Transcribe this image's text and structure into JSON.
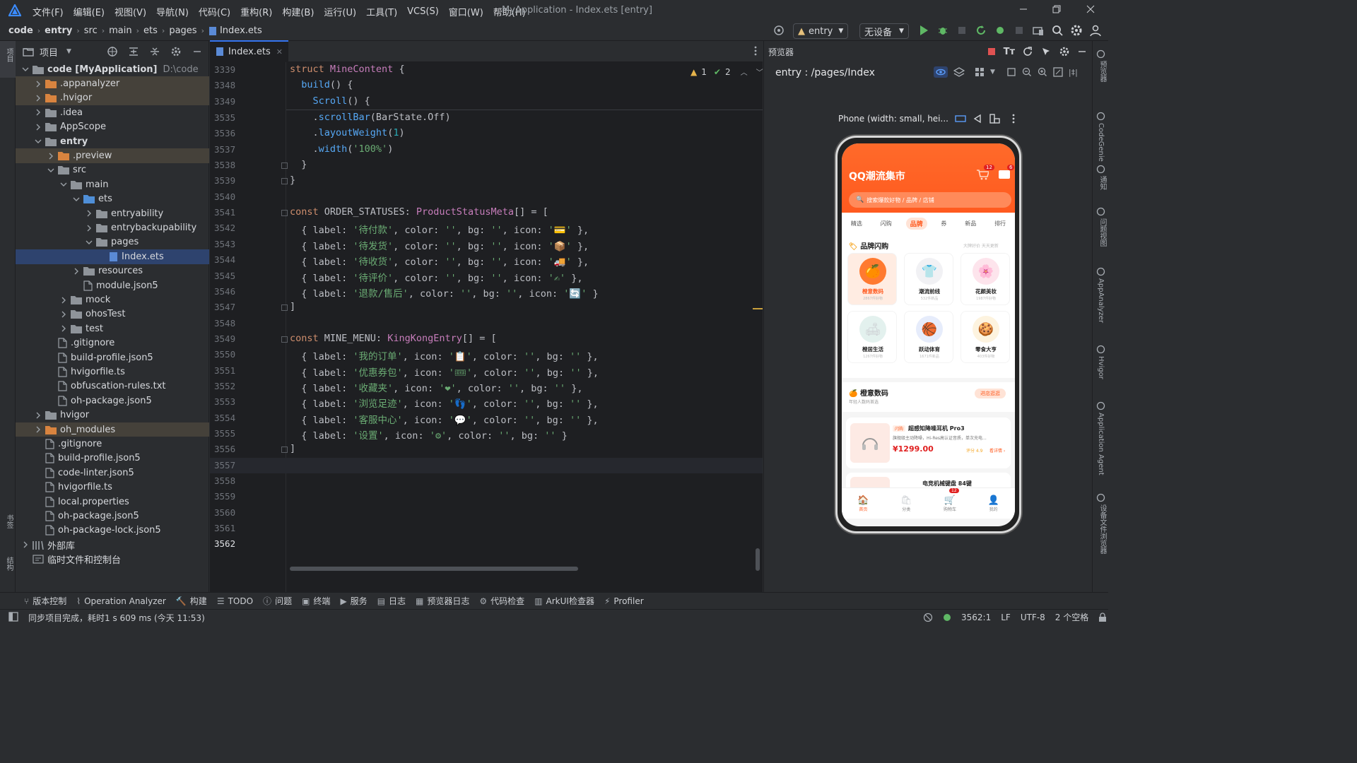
{
  "menu": {
    "items": [
      "文件(F)",
      "编辑(E)",
      "视图(V)",
      "导航(N)",
      "代码(C)",
      "重构(R)",
      "构建(B)",
      "运行(U)",
      "工具(T)",
      "VCS(S)",
      "窗口(W)",
      "帮助(H)"
    ],
    "window_title": "MyApplication - Index.ets [entry]"
  },
  "nav": {
    "breadcrumb": [
      "code",
      "entry",
      "src",
      "main",
      "ets",
      "pages",
      "Index.ets"
    ],
    "run_config": "entry",
    "device": "无设备"
  },
  "project": {
    "title": "项目",
    "rows": [
      {
        "label": "code [MyApplication]",
        "extra": "D:\\code",
        "indent": 0,
        "kind": "folder",
        "exp": "open",
        "bold": true
      },
      {
        "label": ".appanalyzer",
        "indent": 1,
        "kind": "folder-o",
        "exp": "closed",
        "hl": true
      },
      {
        "label": ".hvigor",
        "indent": 1,
        "kind": "folder-o",
        "exp": "closed",
        "hl": true
      },
      {
        "label": ".idea",
        "indent": 1,
        "kind": "folder",
        "exp": "closed"
      },
      {
        "label": "AppScope",
        "indent": 1,
        "kind": "folder",
        "exp": "closed"
      },
      {
        "label": "entry",
        "indent": 1,
        "kind": "folder",
        "exp": "open",
        "bold": true
      },
      {
        "label": ".preview",
        "indent": 2,
        "kind": "folder-o",
        "exp": "closed",
        "hl": true
      },
      {
        "label": "src",
        "indent": 2,
        "kind": "folder",
        "exp": "open"
      },
      {
        "label": "main",
        "indent": 3,
        "kind": "folder",
        "exp": "open"
      },
      {
        "label": "ets",
        "indent": 4,
        "kind": "folder-b",
        "exp": "open"
      },
      {
        "label": "entryability",
        "indent": 5,
        "kind": "folder",
        "exp": "closed"
      },
      {
        "label": "entrybackupability",
        "indent": 5,
        "kind": "folder",
        "exp": "closed"
      },
      {
        "label": "pages",
        "indent": 5,
        "kind": "folder",
        "exp": "open"
      },
      {
        "label": "Index.ets",
        "indent": 6,
        "kind": "file",
        "exp": "none",
        "sel": true
      },
      {
        "label": "resources",
        "indent": 4,
        "kind": "folder",
        "exp": "closed"
      },
      {
        "label": "module.json5",
        "indent": 4,
        "kind": "file",
        "exp": "none"
      },
      {
        "label": "mock",
        "indent": 3,
        "kind": "folder",
        "exp": "closed"
      },
      {
        "label": "ohosTest",
        "indent": 3,
        "kind": "folder",
        "exp": "closed"
      },
      {
        "label": "test",
        "indent": 3,
        "kind": "folder",
        "exp": "closed"
      },
      {
        "label": ".gitignore",
        "indent": 2,
        "kind": "file",
        "exp": "none"
      },
      {
        "label": "build-profile.json5",
        "indent": 2,
        "kind": "file",
        "exp": "none"
      },
      {
        "label": "hvigorfile.ts",
        "indent": 2,
        "kind": "file",
        "exp": "none"
      },
      {
        "label": "obfuscation-rules.txt",
        "indent": 2,
        "kind": "file",
        "exp": "none"
      },
      {
        "label": "oh-package.json5",
        "indent": 2,
        "kind": "file",
        "exp": "none"
      },
      {
        "label": "hvigor",
        "indent": 1,
        "kind": "folder",
        "exp": "closed"
      },
      {
        "label": "oh_modules",
        "indent": 1,
        "kind": "folder-o",
        "exp": "closed",
        "hl": true
      },
      {
        "label": ".gitignore",
        "indent": 1,
        "kind": "file",
        "exp": "none"
      },
      {
        "label": "build-profile.json5",
        "indent": 1,
        "kind": "file",
        "exp": "none"
      },
      {
        "label": "code-linter.json5",
        "indent": 1,
        "kind": "file",
        "exp": "none"
      },
      {
        "label": "hvigorfile.ts",
        "indent": 1,
        "kind": "file",
        "exp": "none"
      },
      {
        "label": "local.properties",
        "indent": 1,
        "kind": "file",
        "exp": "none"
      },
      {
        "label": "oh-package.json5",
        "indent": 1,
        "kind": "file",
        "exp": "none"
      },
      {
        "label": "oh-package-lock.json5",
        "indent": 1,
        "kind": "file",
        "exp": "none"
      },
      {
        "label": "外部库",
        "indent": 0,
        "kind": "lib",
        "exp": "closed"
      },
      {
        "label": "临时文件和控制台",
        "indent": 0,
        "kind": "scratch",
        "exp": "none"
      }
    ]
  },
  "editor": {
    "tab": "Index.ets",
    "warnings": "1",
    "checks": "2",
    "sticky": [
      {
        "n": "3339",
        "t": [
          [
            "kw",
            "struct "
          ],
          [
            "ty",
            "MineContent "
          ],
          [
            "pl",
            "{"
          ]
        ]
      },
      {
        "n": "3348",
        "t": [
          [
            "pl",
            "  "
          ],
          [
            "fn",
            "build"
          ],
          [
            "pl",
            "() {"
          ]
        ]
      },
      {
        "n": "3349",
        "t": [
          [
            "pl",
            "    "
          ],
          [
            "fn",
            "Scroll"
          ],
          [
            "pl",
            "() {"
          ]
        ]
      }
    ],
    "lines": [
      {
        "n": "3535",
        "t": [
          [
            "pl",
            "    ."
          ],
          [
            "fn",
            "scrollBar"
          ],
          [
            "pl",
            "(BarState.Off)"
          ]
        ]
      },
      {
        "n": "3536",
        "t": [
          [
            "pl",
            "    ."
          ],
          [
            "fn",
            "layoutWeight"
          ],
          [
            "pl",
            "("
          ],
          [
            "nu",
            "1"
          ],
          [
            "pl",
            ")"
          ]
        ]
      },
      {
        "n": "3537",
        "t": [
          [
            "pl",
            "    ."
          ],
          [
            "fn",
            "width"
          ],
          [
            "pl",
            "("
          ],
          [
            "st",
            "'100%'"
          ],
          [
            "pl",
            ")"
          ]
        ]
      },
      {
        "n": "3538",
        "t": [
          [
            "pl",
            "  }"
          ]
        ]
      },
      {
        "n": "3539",
        "t": [
          [
            "pl",
            "}"
          ]
        ]
      },
      {
        "n": "3540",
        "t": []
      },
      {
        "n": "3541",
        "t": [
          [
            "kw",
            "const "
          ],
          [
            "pl",
            "ORDER_STATUSES: "
          ],
          [
            "ty",
            "ProductStatusMeta"
          ],
          [
            "pl",
            "[] = ["
          ]
        ]
      },
      {
        "n": "3542",
        "t": [
          [
            "pl",
            "  { label: "
          ],
          [
            "st",
            "'待付款'"
          ],
          [
            "pl",
            ", color: "
          ],
          [
            "st",
            "''"
          ],
          [
            "pl",
            ", bg: "
          ],
          [
            "st",
            "''"
          ],
          [
            "pl",
            ", icon: "
          ],
          [
            "st",
            "'💳'"
          ],
          [
            "pl",
            " },"
          ]
        ]
      },
      {
        "n": "3543",
        "t": [
          [
            "pl",
            "  { label: "
          ],
          [
            "st",
            "'待发货'"
          ],
          [
            "pl",
            ", color: "
          ],
          [
            "st",
            "''"
          ],
          [
            "pl",
            ", bg: "
          ],
          [
            "st",
            "''"
          ],
          [
            "pl",
            ", icon: "
          ],
          [
            "st",
            "'📦'"
          ],
          [
            "pl",
            " },"
          ]
        ]
      },
      {
        "n": "3544",
        "t": [
          [
            "pl",
            "  { label: "
          ],
          [
            "st",
            "'待收货'"
          ],
          [
            "pl",
            ", color: "
          ],
          [
            "st",
            "''"
          ],
          [
            "pl",
            ", bg: "
          ],
          [
            "st",
            "''"
          ],
          [
            "pl",
            ", icon: "
          ],
          [
            "st",
            "'🚚'"
          ],
          [
            "pl",
            " },"
          ]
        ]
      },
      {
        "n": "3545",
        "t": [
          [
            "pl",
            "  { label: "
          ],
          [
            "st",
            "'待评价'"
          ],
          [
            "pl",
            ", color: "
          ],
          [
            "st",
            "''"
          ],
          [
            "pl",
            ", bg: "
          ],
          [
            "st",
            "''"
          ],
          [
            "pl",
            ", icon: "
          ],
          [
            "st",
            "'✍'"
          ],
          [
            "pl",
            " },"
          ]
        ]
      },
      {
        "n": "3546",
        "t": [
          [
            "pl",
            "  { label: "
          ],
          [
            "st",
            "'退款/售后'"
          ],
          [
            "pl",
            ", color: "
          ],
          [
            "st",
            "''"
          ],
          [
            "pl",
            ", bg: "
          ],
          [
            "st",
            "''"
          ],
          [
            "pl",
            ", icon: "
          ],
          [
            "st",
            "'🔄'"
          ],
          [
            "pl",
            " }"
          ]
        ]
      },
      {
        "n": "3547",
        "t": [
          [
            "pl",
            "]"
          ]
        ]
      },
      {
        "n": "3548",
        "t": []
      },
      {
        "n": "3549",
        "t": [
          [
            "kw",
            "const "
          ],
          [
            "pl",
            "MINE_MENU: "
          ],
          [
            "ty",
            "KingKongEntry"
          ],
          [
            "pl",
            "[] = ["
          ]
        ]
      },
      {
        "n": "3550",
        "t": [
          [
            "pl",
            "  { label: "
          ],
          [
            "st",
            "'我的订单'"
          ],
          [
            "pl",
            ", icon: "
          ],
          [
            "st",
            "'📋'"
          ],
          [
            "pl",
            ", color: "
          ],
          [
            "st",
            "''"
          ],
          [
            "pl",
            ", bg: "
          ],
          [
            "st",
            "''"
          ],
          [
            "pl",
            " },"
          ]
        ]
      },
      {
        "n": "3551",
        "t": [
          [
            "pl",
            "  { label: "
          ],
          [
            "st",
            "'优惠券包'"
          ],
          [
            "pl",
            ", icon: "
          ],
          [
            "st",
            "'🎟'"
          ],
          [
            "pl",
            ", color: "
          ],
          [
            "st",
            "''"
          ],
          [
            "pl",
            ", bg: "
          ],
          [
            "st",
            "''"
          ],
          [
            "pl",
            " },"
          ]
        ]
      },
      {
        "n": "3552",
        "t": [
          [
            "pl",
            "  { label: "
          ],
          [
            "st",
            "'收藏夹'"
          ],
          [
            "pl",
            ", icon: "
          ],
          [
            "st",
            "'❤'"
          ],
          [
            "pl",
            ", color: "
          ],
          [
            "st",
            "''"
          ],
          [
            "pl",
            ", bg: "
          ],
          [
            "st",
            "''"
          ],
          [
            "pl",
            " },"
          ]
        ]
      },
      {
        "n": "3553",
        "t": [
          [
            "pl",
            "  { label: "
          ],
          [
            "st",
            "'浏览足迹'"
          ],
          [
            "pl",
            ", icon: "
          ],
          [
            "st",
            "'👣'"
          ],
          [
            "pl",
            ", color: "
          ],
          [
            "st",
            "''"
          ],
          [
            "pl",
            ", bg: "
          ],
          [
            "st",
            "''"
          ],
          [
            "pl",
            " },"
          ]
        ]
      },
      {
        "n": "3554",
        "t": [
          [
            "pl",
            "  { label: "
          ],
          [
            "st",
            "'客服中心'"
          ],
          [
            "pl",
            ", icon: "
          ],
          [
            "st",
            "'💬'"
          ],
          [
            "pl",
            ", color: "
          ],
          [
            "st",
            "''"
          ],
          [
            "pl",
            ", bg: "
          ],
          [
            "st",
            "''"
          ],
          [
            "pl",
            " },"
          ]
        ]
      },
      {
        "n": "3555",
        "t": [
          [
            "pl",
            "  { label: "
          ],
          [
            "st",
            "'设置'"
          ],
          [
            "pl",
            ", icon: "
          ],
          [
            "st",
            "'⚙'"
          ],
          [
            "pl",
            ", color: "
          ],
          [
            "st",
            "''"
          ],
          [
            "pl",
            ", bg: "
          ],
          [
            "st",
            "''"
          ],
          [
            "pl",
            " }"
          ]
        ]
      },
      {
        "n": "3556",
        "t": [
          [
            "pl",
            "]"
          ]
        ]
      },
      {
        "n": "3557",
        "t": []
      },
      {
        "n": "3558",
        "t": []
      },
      {
        "n": "3559",
        "t": []
      },
      {
        "n": "3560",
        "t": []
      },
      {
        "n": "3561",
        "t": []
      },
      {
        "n": "3562",
        "t": []
      }
    ]
  },
  "previewer": {
    "title": "预览器",
    "route": "entry : /pages/Index",
    "device_label": "Phone (width: small, hei...",
    "app": {
      "title": "QQ潮流集市",
      "cart_badge": "12",
      "msg_badge": "6",
      "search_placeholder": "搜索爆款好物 / 品牌 / 店铺",
      "tabs": [
        "精选",
        "闪购",
        "品牌",
        "券",
        "新品",
        "排行"
      ],
      "section_title": "品牌闪购",
      "section_hint": "大牌好价 天天更新",
      "brands": [
        {
          "name": "橙意数码",
          "sub": "2867件好物",
          "emoji": "🍊"
        },
        {
          "name": "潮流前线",
          "sub": "532件新品",
          "emoji": "👕"
        },
        {
          "name": "花颜美妆",
          "sub": "1987件好物",
          "emoji": "🌸"
        },
        {
          "name": "橙居生活",
          "sub": "1267件好物",
          "emoji": "🛋"
        },
        {
          "name": "跃动体育",
          "sub": "1671件新品",
          "emoji": "🏀"
        },
        {
          "name": "零食大亨",
          "sub": "403件好物",
          "emoji": "🍪"
        }
      ],
      "shop_name": "橙意数码",
      "shop_sub": "年轻人数码首选",
      "shop_btn": "进店逛逛",
      "product_tag": "闪购",
      "product_name": "超感知降噪耳机 Pro3",
      "product_desc": "旗舰级主动降噪，Hi-Res高认证音质，单次充电...",
      "product_price": "¥1299.00",
      "product_rating": "评分 4.9",
      "product_link": "看详情 ›",
      "product2_name": "电竞机械键盘 84键",
      "bottom_nav": [
        "首页",
        "分类",
        "购物车",
        "我的"
      ],
      "bottom_badge": "12"
    }
  },
  "toolwindows": [
    "版本控制",
    "Operation Analyzer",
    "构建",
    "TODO",
    "问题",
    "终端",
    "服务",
    "日志",
    "预览器日志",
    "代码检查",
    "ArkUI检查器",
    "Profiler"
  ],
  "status": {
    "message": "同步项目完成，耗时1 s 609 ms (今天 11:53)",
    "position": "3562:1",
    "line_sep": "LF",
    "encoding": "UTF-8",
    "indent": "2 个空格"
  },
  "side_left": [
    "项目",
    "书签",
    "结构"
  ],
  "side_right": [
    "预览器",
    "CodeGenie",
    "通知",
    "问题视图",
    "AppAnalyzer",
    "Hvigor",
    "Application Agent",
    "设备文件浏览器"
  ],
  "colors": {
    "accent": "#3574f0",
    "orange": "#ff5a1f",
    "bg": "#2b2d30",
    "editor": "#1e1f22"
  }
}
